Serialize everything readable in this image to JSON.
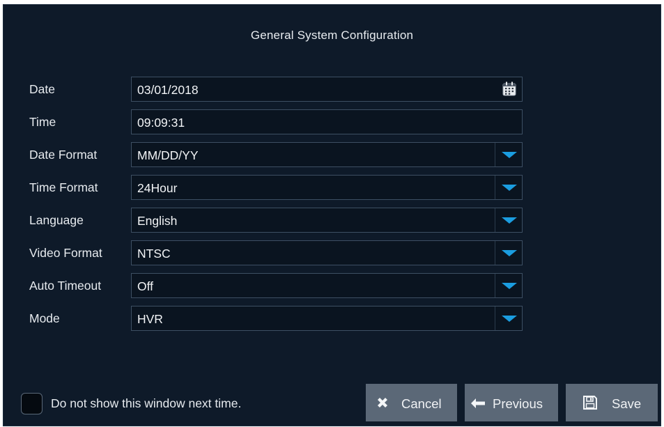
{
  "dialog": {
    "title": "General System Configuration"
  },
  "fields": [
    {
      "label": "Date",
      "value": "03/01/2018",
      "control": "date-picker",
      "icon": "calendar-icon"
    },
    {
      "label": "Time",
      "value": "09:09:31",
      "control": "text"
    },
    {
      "label": "Date Format",
      "value": "MM/DD/YY",
      "control": "dropdown"
    },
    {
      "label": "Time Format",
      "value": "24Hour",
      "control": "dropdown"
    },
    {
      "label": "Language",
      "value": "English",
      "control": "dropdown"
    },
    {
      "label": "Video Format",
      "value": "NTSC",
      "control": "dropdown"
    },
    {
      "label": "Auto Timeout",
      "value": "Off",
      "control": "dropdown"
    },
    {
      "label": "Mode",
      "value": "HVR",
      "control": "dropdown"
    }
  ],
  "footer": {
    "checkbox_label": "Do not show this window next time.",
    "checkbox_checked": false,
    "buttons": {
      "cancel": {
        "label": "Cancel",
        "icon": "close-x-icon"
      },
      "previous": {
        "label": "Previous",
        "icon": "arrow-left-icon"
      },
      "save": {
        "label": "Save",
        "icon": "floppy-disk-icon"
      }
    }
  },
  "colors": {
    "background": "#0e1a29",
    "field_background": "#0a1420",
    "field_border": "#3d4f63",
    "dropdown_arrow": "#1b9de0",
    "button_background": "#5b6877"
  }
}
